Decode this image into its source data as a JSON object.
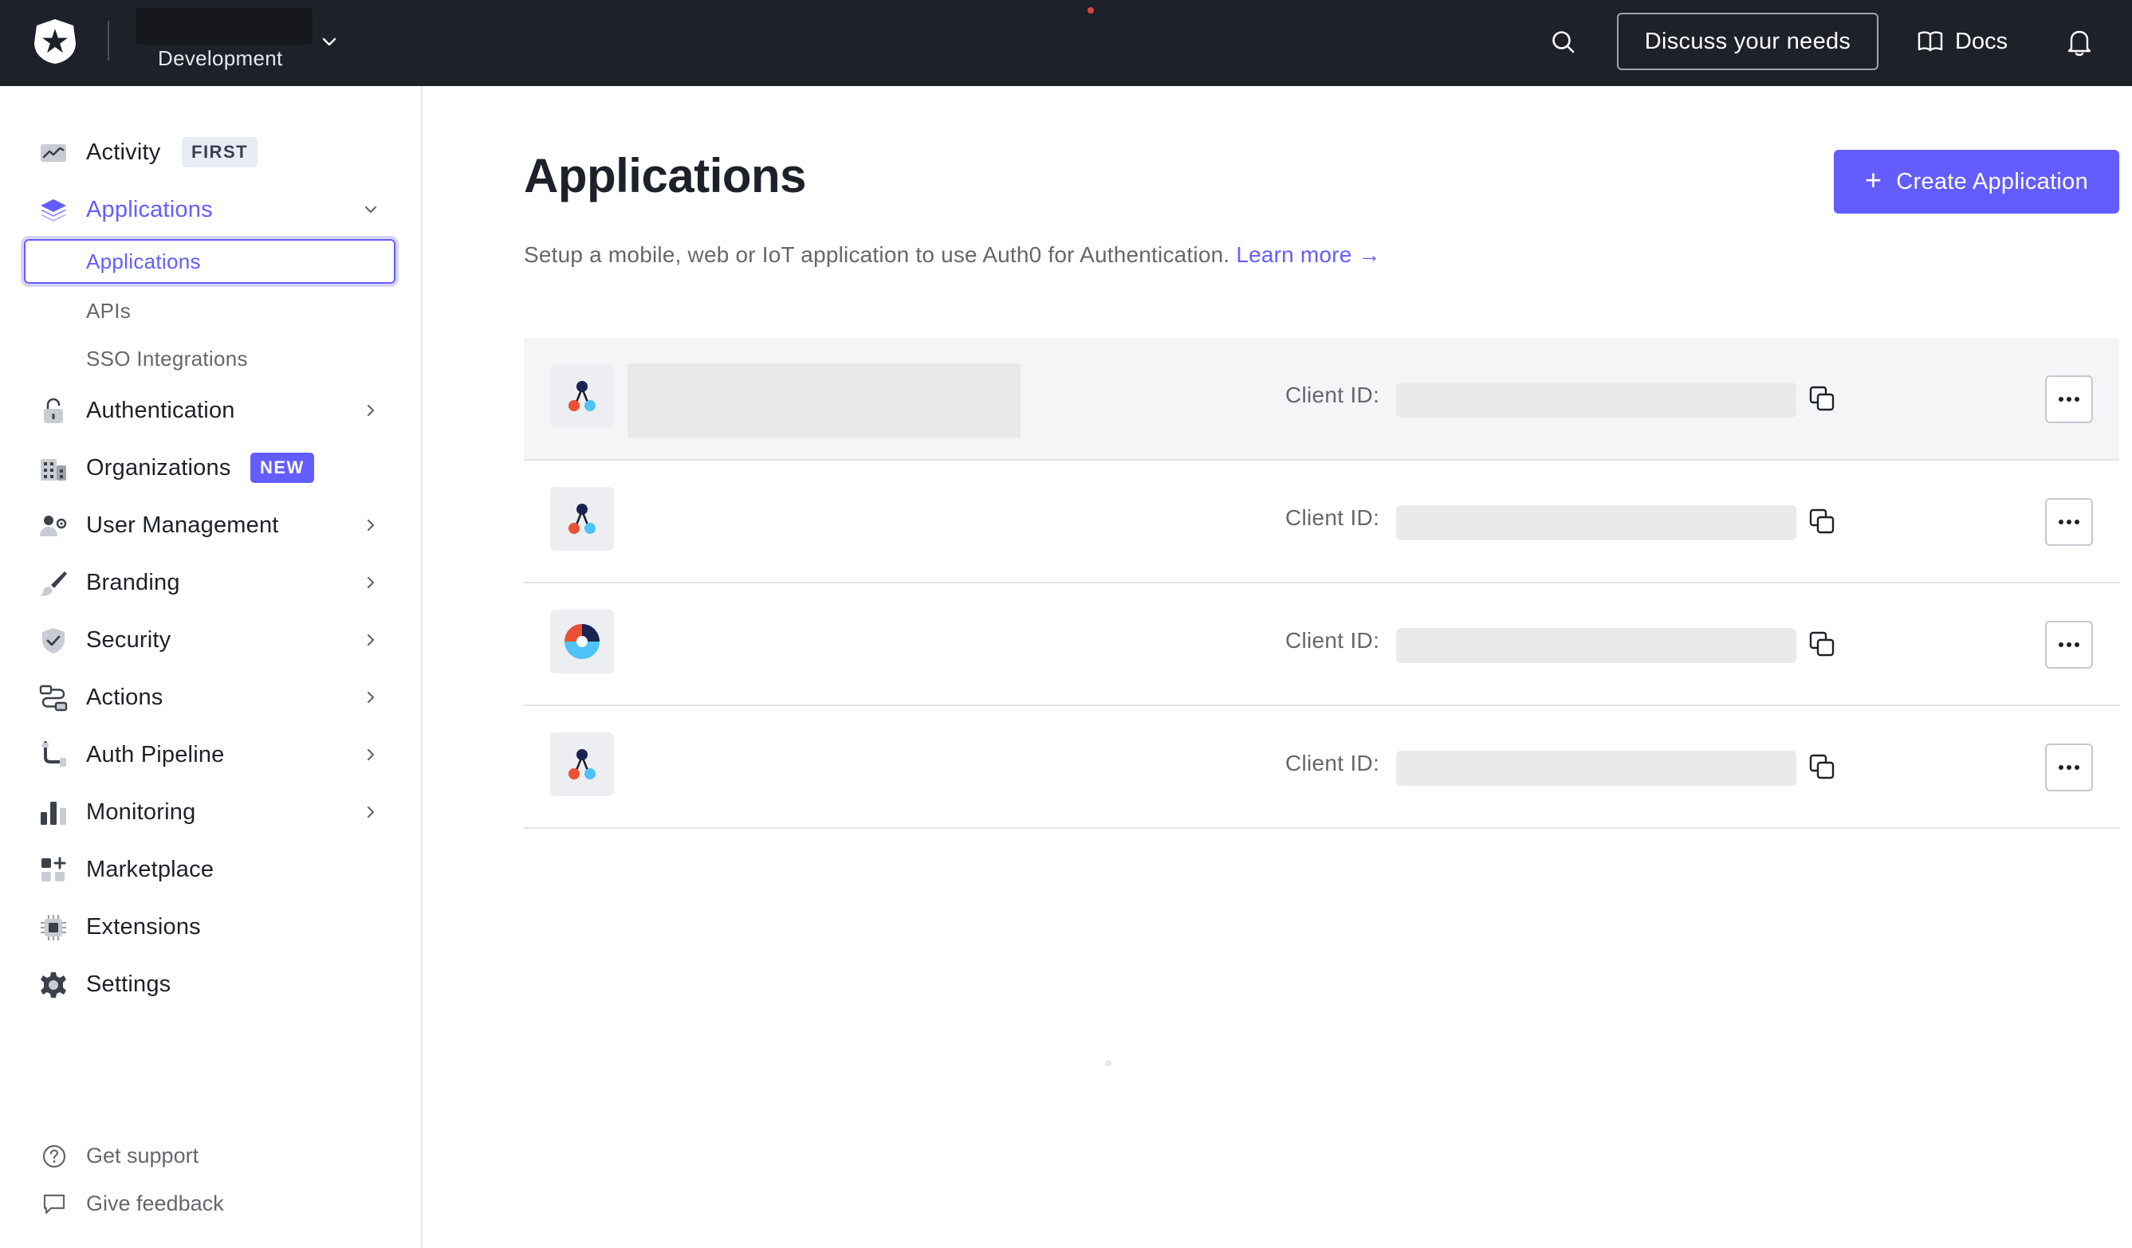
{
  "topbar": {
    "tenant_environment": "Development",
    "discuss_label": "Discuss your needs",
    "docs_label": "Docs"
  },
  "sidebar": {
    "items": [
      {
        "label": "Activity",
        "icon": "activity-chart-icon",
        "badge": "FIRST"
      },
      {
        "label": "Applications",
        "icon": "layers-icon",
        "expanded": true
      },
      {
        "label": "Authentication",
        "icon": "lock-icon"
      },
      {
        "label": "Organizations",
        "icon": "building-icon",
        "badge": "NEW"
      },
      {
        "label": "User Management",
        "icon": "users-gear-icon"
      },
      {
        "label": "Branding",
        "icon": "brush-icon"
      },
      {
        "label": "Security",
        "icon": "shield-check-icon"
      },
      {
        "label": "Actions",
        "icon": "actions-flow-icon"
      },
      {
        "label": "Auth Pipeline",
        "icon": "pipeline-icon"
      },
      {
        "label": "Monitoring",
        "icon": "bar-chart-icon"
      },
      {
        "label": "Marketplace",
        "icon": "grid-plus-icon"
      },
      {
        "label": "Extensions",
        "icon": "chip-icon"
      },
      {
        "label": "Settings",
        "icon": "gear-icon"
      }
    ],
    "sub_items": [
      "Applications",
      "APIs",
      "SSO Integrations"
    ],
    "footer": [
      {
        "label": "Get support",
        "icon": "help-circle-icon"
      },
      {
        "label": "Give feedback",
        "icon": "chat-bubble-icon"
      }
    ]
  },
  "main": {
    "title": "Applications",
    "create_label": "Create Application",
    "subtitle": "Setup a mobile, web or IoT application to use Auth0 for Authentication.",
    "learn_more": "Learn more →",
    "client_id_label": "Client ID:",
    "apps": [
      {
        "type": "generic-app-icon"
      },
      {
        "type": "generic-app-icon"
      },
      {
        "type": "auth0-donut-icon"
      },
      {
        "type": "generic-app-icon"
      }
    ]
  },
  "colors": {
    "topbar_bg": "#1e212a",
    "accent": "#635dff",
    "text": "#1e212a",
    "muted_text": "#65676e"
  }
}
